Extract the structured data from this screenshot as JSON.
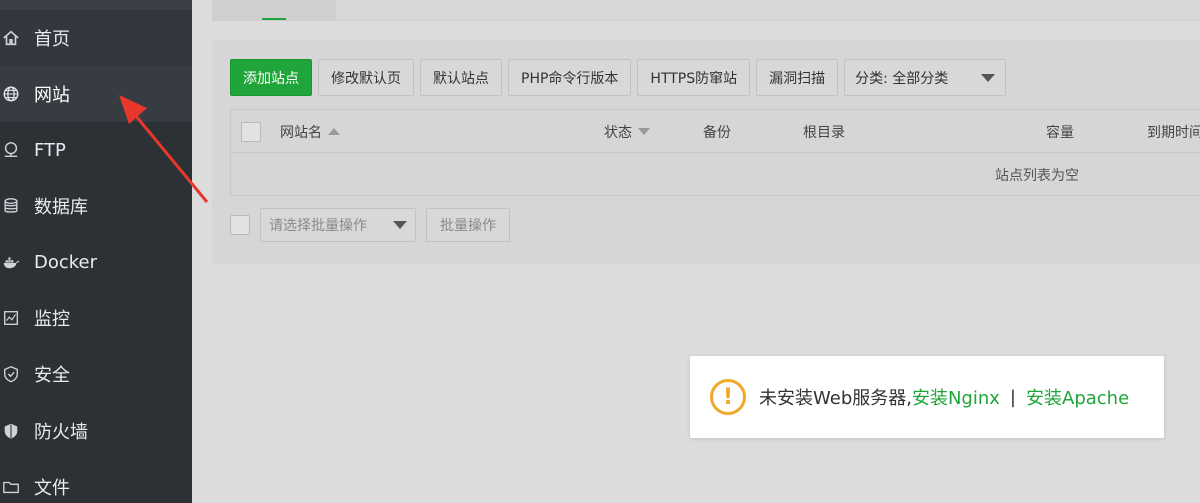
{
  "sidebar": {
    "items": [
      {
        "label": "首页",
        "icon": "home-icon"
      },
      {
        "label": "网站",
        "icon": "globe-icon"
      },
      {
        "label": "FTP",
        "icon": "ftp-icon"
      },
      {
        "label": "数据库",
        "icon": "database-icon"
      },
      {
        "label": "Docker",
        "icon": "docker-icon"
      },
      {
        "label": "监控",
        "icon": "monitor-icon"
      },
      {
        "label": "安全",
        "icon": "shield-icon"
      },
      {
        "label": "防火墙",
        "icon": "firewall-icon"
      },
      {
        "label": "文件",
        "icon": "folder-icon"
      }
    ],
    "active": "网站"
  },
  "toolbar": {
    "add_site": "添加站点",
    "edit_default_page": "修改默认页",
    "default_site": "默认站点",
    "php_cli_version": "PHP命令行版本",
    "https_protect": "HTTPS防窜站",
    "vuln_scan": "漏洞扫描",
    "category_select": "分类: 全部分类"
  },
  "table": {
    "columns": {
      "name": "网站名",
      "status": "状态",
      "backup": "备份",
      "root": "根目录",
      "capacity": "容量",
      "expire": "到期时间"
    },
    "empty_text": "站点列表为空"
  },
  "batch": {
    "select_placeholder": "请选择批量操作",
    "button": "批量操作"
  },
  "toast": {
    "message": "未安装Web服务器,",
    "install_nginx": "安装Nginx",
    "separator": "|",
    "install_apache": "安装Apache"
  },
  "colors": {
    "sidebar_bg": "#2c3136",
    "primary_green": "#20a53a",
    "warning_orange": "#f0a82b"
  }
}
